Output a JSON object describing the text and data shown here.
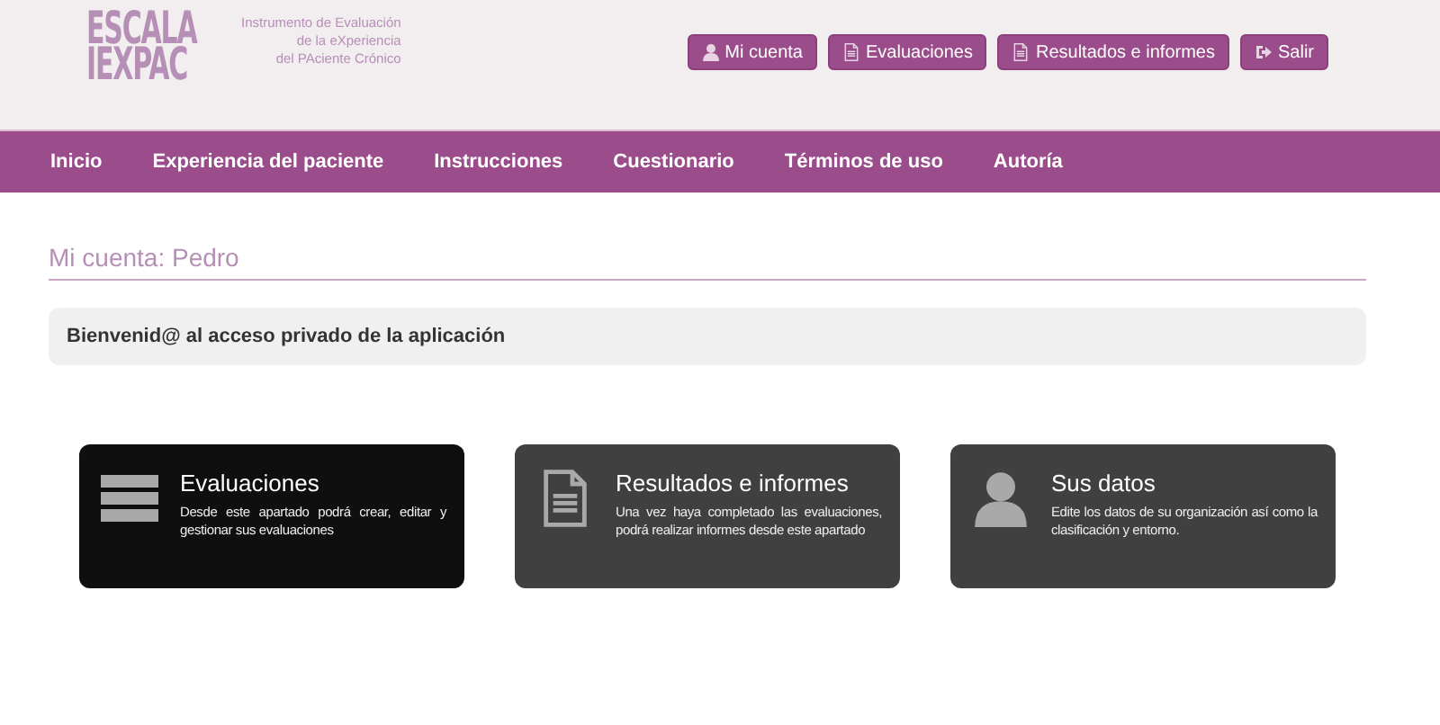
{
  "logo": {
    "lines": [
      "ESCALA",
      "IEXPAC"
    ],
    "tagline": [
      "Instrumento de Evaluación",
      "de la eXperiencia",
      "del PAciente Crónico"
    ]
  },
  "header_buttons": [
    {
      "label": "Mi cuenta",
      "kind": "user"
    },
    {
      "label": "Evaluaciones",
      "kind": "document"
    },
    {
      "label": "Resultados e informes",
      "kind": "document"
    },
    {
      "label": "Salir",
      "kind": "exit"
    }
  ],
  "nav": [
    "Inicio",
    "Experiencia del paciente",
    "Instrucciones",
    "Cuestionario",
    "Términos de uso",
    "Autoría"
  ],
  "page_title": "Mi cuenta: Pedro",
  "welcome": "Bienvenid@ al acceso privado de la aplicación",
  "cards": [
    {
      "title": "Evaluaciones",
      "text": "Desde este apartado podrá crear, editar y gestionar sus evaluaciones",
      "kind": "server",
      "selected": true
    },
    {
      "title": "Resultados e informes",
      "text": "Una vez haya completado las evaluaciones, podrá realizar informes desde este apartado",
      "kind": "document",
      "selected": false
    },
    {
      "title": "Sus datos",
      "text": "Edite los datos de su organización así como la clasificación y entorno.",
      "kind": "user",
      "selected": false
    }
  ]
}
